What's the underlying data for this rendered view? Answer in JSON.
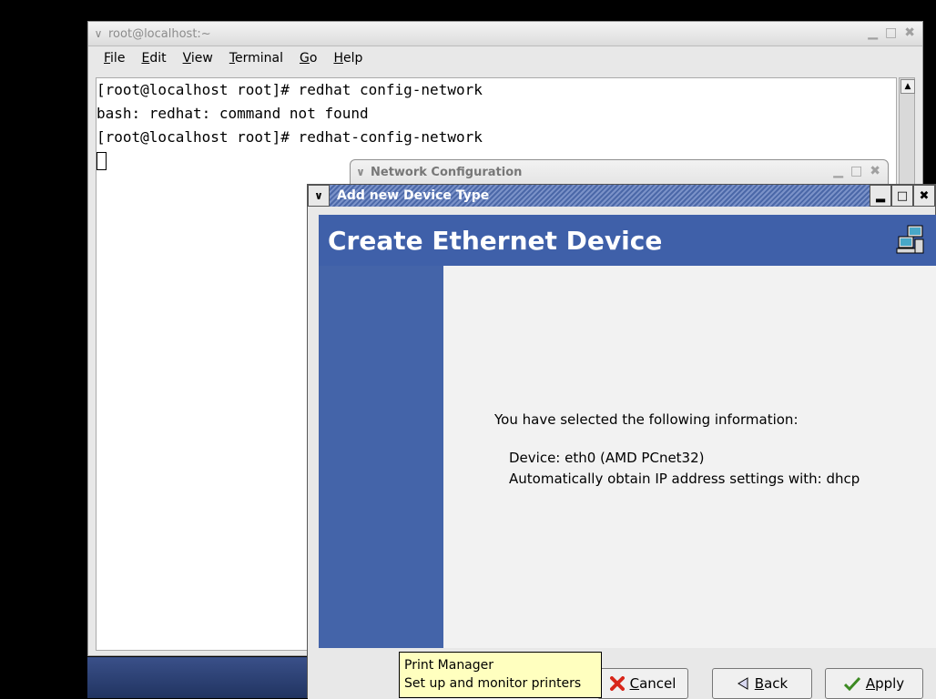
{
  "terminal": {
    "title": "root@localhost:~",
    "menu": [
      {
        "accel": "F",
        "rest": "ile"
      },
      {
        "accel": "E",
        "rest": "dit"
      },
      {
        "accel": "V",
        "rest": "iew"
      },
      {
        "accel": "T",
        "rest": "erminal"
      },
      {
        "accel": "G",
        "rest": "o"
      },
      {
        "accel": "H",
        "rest": "elp"
      }
    ],
    "lines": [
      "[root@localhost root]# redhat config-network",
      "bash: redhat: command not found",
      "[root@localhost root]# redhat-config-network"
    ]
  },
  "netconf": {
    "title": "Network Configuration"
  },
  "dialog": {
    "title": "Add new Device Type",
    "header": "Create Ethernet Device",
    "info_intro": "You have selected the following information:",
    "device_line": "Device: eth0 (AMD PCnet32)",
    "ip_line": "Automatically obtain IP address settings with: dhcp",
    "buttons": {
      "cancel": {
        "accel": "C",
        "rest": "ancel"
      },
      "back": {
        "accel": "B",
        "rest": "ack"
      },
      "apply": {
        "accel": "A",
        "rest": "pply"
      }
    }
  },
  "tooltip": {
    "title": "Print Manager",
    "desc": "Set up and monitor printers"
  },
  "icons": {
    "window_menu": "chevron-down-icon",
    "minimize": "minimize-icon",
    "maximize": "maximize-icon",
    "close": "close-icon",
    "network": "network-computers-icon",
    "cancel": "red-x-icon",
    "back": "left-triangle-icon",
    "apply": "checkmark-icon"
  },
  "colors": {
    "druid_blue": "#3f60a9",
    "tooltip_bg": "#ffffbf",
    "title_stripe": "#4b68a8"
  }
}
